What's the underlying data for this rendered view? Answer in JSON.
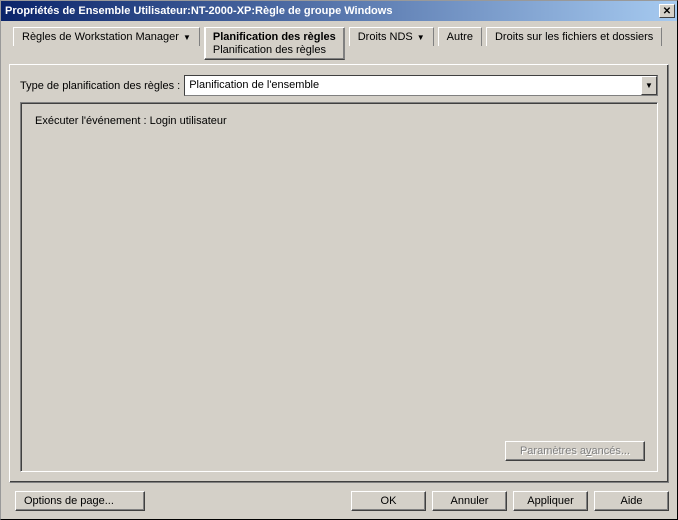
{
  "window": {
    "title": "Propriétés de Ensemble Utilisateur:NT-2000-XP:Règle de groupe Windows",
    "close_glyph": "✕"
  },
  "tabs": {
    "workstation": "Règles de Workstation Manager",
    "planning_main": "Planification des règles",
    "planning_sub": "Planification des règles",
    "nds": "Droits NDS",
    "other": "Autre",
    "files": "Droits sur les fichiers et dossiers"
  },
  "schedule": {
    "label": "Type de planification des règles :",
    "selected": "Planification de l'ensemble",
    "event_text": "Exécuter l'événement : Login utilisateur",
    "advanced_prefix": "Paramètres a",
    "advanced_ul": "v",
    "advanced_suffix": "ancés..."
  },
  "buttons": {
    "page_options": "Options de page...",
    "ok": "OK",
    "cancel": "Annuler",
    "apply": "Appliquer",
    "help": "Aide"
  }
}
